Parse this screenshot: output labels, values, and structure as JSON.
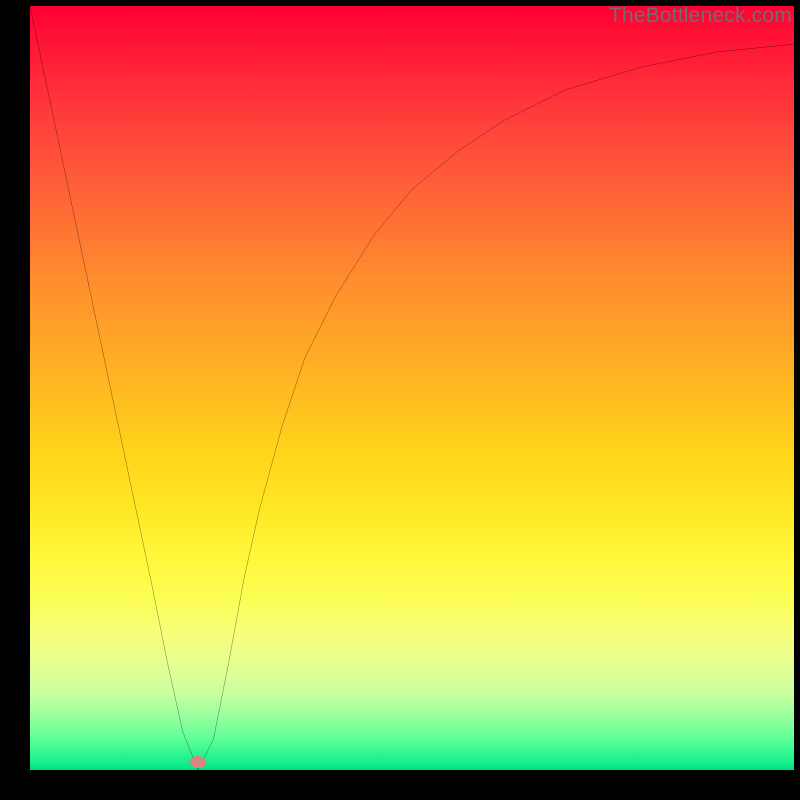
{
  "watermark": "TheBottleneck.com",
  "chart_data": {
    "type": "line",
    "title": "",
    "xlabel": "",
    "ylabel": "",
    "xlim": [
      0,
      100
    ],
    "ylim": [
      0,
      100
    ],
    "grid": false,
    "legend": false,
    "series": [
      {
        "name": "bottleneck-curve",
        "x": [
          0,
          4,
          8,
          12,
          16,
          18,
          20,
          22,
          24,
          26,
          28,
          30,
          33,
          36,
          40,
          45,
          50,
          56,
          62,
          70,
          80,
          90,
          100
        ],
        "y": [
          100,
          81,
          62,
          43,
          24,
          14,
          5,
          0,
          4,
          14,
          25,
          34,
          45,
          54,
          62,
          70,
          76,
          81,
          85,
          89,
          92,
          94,
          95
        ]
      }
    ],
    "annotations": [
      {
        "name": "optimal-marker",
        "x": 22,
        "y": 1
      }
    ],
    "colors": {
      "top": "#ff0033",
      "mid": "#ffd31a",
      "bottom": "#00e082",
      "curve": "#000000",
      "marker": "#d9867f"
    }
  }
}
